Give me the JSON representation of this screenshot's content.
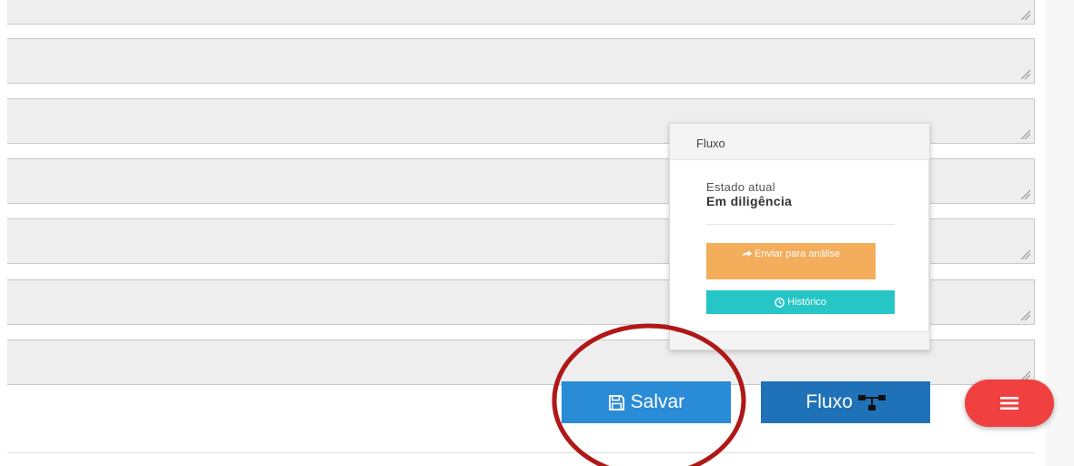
{
  "form": {
    "textarea_count": 7
  },
  "fluxo_panel": {
    "title": "Fluxo",
    "state_label": "Estado atual",
    "state_value": "Em diligência",
    "send_button": "Enviar para análise",
    "history_button": "Histórico"
  },
  "actions": {
    "save_label": "Salvar",
    "flow_label": "Fluxo"
  },
  "colors": {
    "save": "#2a8bd6",
    "flow": "#1f72b8",
    "fab": "#f04040",
    "send": "#f3ad5b",
    "history": "#26c6c6",
    "annotation": "#b01818"
  },
  "icons": {
    "save": "floppy-disk-icon",
    "flow": "sitemap-icon",
    "fab": "menu-bars-icon",
    "send": "arrow-right-icon",
    "history": "clock-icon",
    "resize": "resize-grip-icon"
  }
}
